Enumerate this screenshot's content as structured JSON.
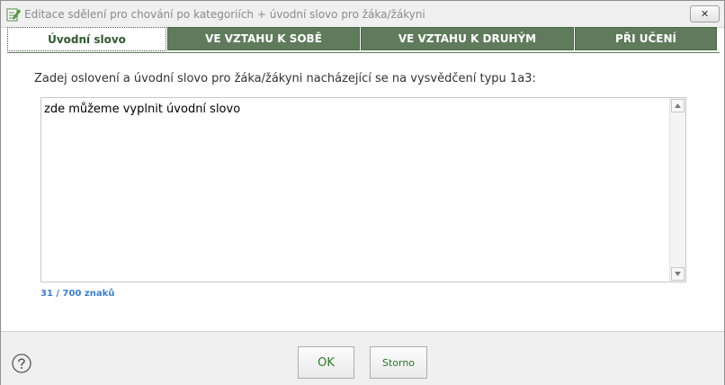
{
  "window": {
    "title": "Editace sdělení pro chování po kategoriích + úvodní slovo pro žáka/žákyni",
    "close_symbol": "✕",
    "icon": "edit-notepad-icon",
    "accent_color": "#5f7b5b"
  },
  "tabs": [
    {
      "label": "Úvodní slovo",
      "active": true
    },
    {
      "label": "VE VZTAHU K SOBĚ",
      "active": false
    },
    {
      "label": "VE VZTAHU K DRUHÝM",
      "active": false
    },
    {
      "label": "PŘI UČENÍ",
      "active": false
    }
  ],
  "main": {
    "prompt": "Zadej oslovení a úvodní slovo pro žáka/žákyni nacházející se na vysvědčení typu 1a3:",
    "text_value": "zde můžeme vyplnit úvodní slovo",
    "char_counter": "31 / 700 znaků"
  },
  "footer": {
    "help_icon": "help-question-icon",
    "ok_label": "OK",
    "cancel_label": "Storno"
  }
}
